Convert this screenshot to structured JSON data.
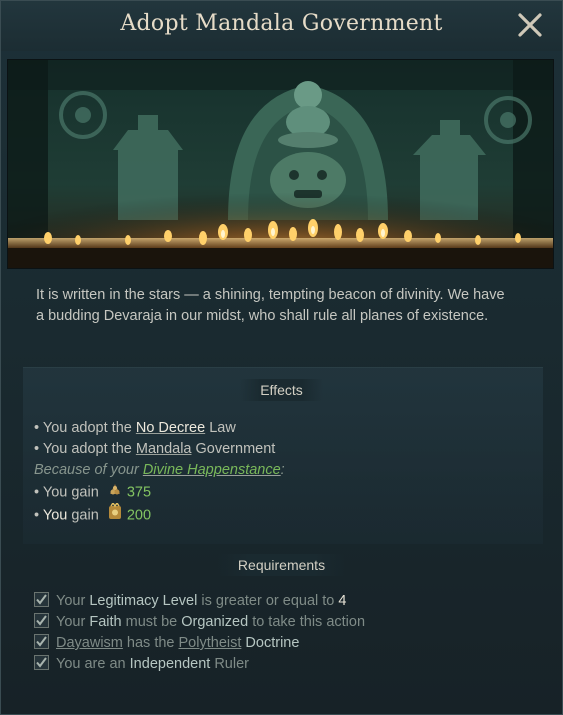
{
  "window": {
    "title": "Adopt Mandala Government"
  },
  "description": "It is written in the stars — a shining, tempting beacon of divinity. We have a budding Devaraja in our midst, who shall rule all planes of existence.",
  "effects": {
    "heading": "Effects",
    "line1": {
      "bullet": "•",
      "pre": "You adopt the",
      "link": "No Decree",
      "post": "Law"
    },
    "line2": {
      "bullet": "•",
      "pre": "You adopt the",
      "link": "Mandala",
      "post": "Government"
    },
    "because": {
      "pre": "Because of your",
      "link": "Divine Happenstance",
      "post": ":"
    },
    "gain1": {
      "bullet": "•",
      "pre": "You gain",
      "icon": "gold-coins-icon",
      "value": "375"
    },
    "gain2": {
      "bullet": "•",
      "pre_bold": "You",
      "pre": "gain",
      "icon": "legitimacy-icon",
      "value": "200"
    }
  },
  "requirements": {
    "heading": "Requirements",
    "r1": {
      "a": "Your",
      "b": "Legitimacy Level",
      "c": "is greater or equal to",
      "d": "4"
    },
    "r2": {
      "a": "Your",
      "b": "Faith",
      "c": "must be",
      "d": "Organized",
      "e": "to take this action"
    },
    "r3": {
      "a": "Dayawism",
      "b": "has the",
      "c": "Polytheist",
      "d": "Doctrine"
    },
    "r4": {
      "a": "You are an",
      "b": "Independent",
      "c": "Ruler"
    }
  },
  "colors": {
    "gain_value": "#83c462",
    "because_link": "#79b85a",
    "background": "#1a2b31"
  }
}
